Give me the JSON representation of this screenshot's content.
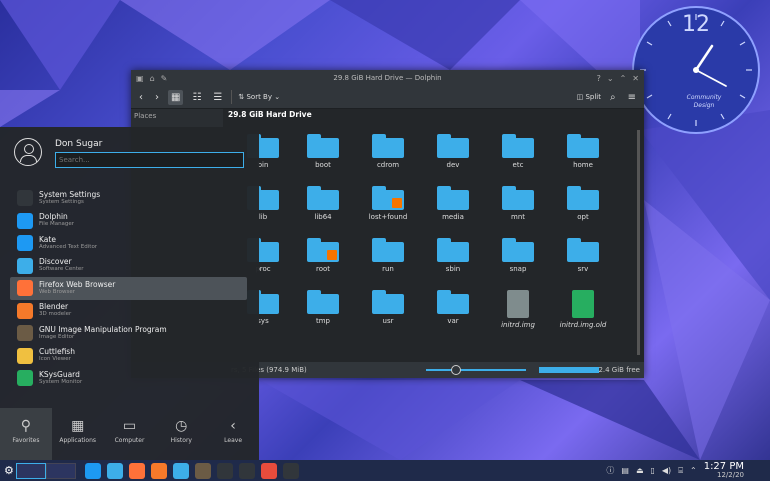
{
  "clock_widget": {
    "twelve": "12",
    "brand_line1": "Community",
    "brand_line2": "Design"
  },
  "dolphin": {
    "title": "29.8 GiB Hard Drive — Dolphin",
    "help": "?",
    "sort_by": "Sort By",
    "split": "Split",
    "places": "Places",
    "breadcrumb": "29.8 GiB Hard Drive",
    "files": [
      {
        "name": "bin",
        "type": "folder"
      },
      {
        "name": "boot",
        "type": "folder"
      },
      {
        "name": "cdrom",
        "type": "folder"
      },
      {
        "name": "dev",
        "type": "folder"
      },
      {
        "name": "etc",
        "type": "folder"
      },
      {
        "name": "home",
        "type": "folder"
      },
      {
        "name": "lib",
        "type": "folder"
      },
      {
        "name": "lib64",
        "type": "folder"
      },
      {
        "name": "lost+found",
        "type": "folder-locked"
      },
      {
        "name": "media",
        "type": "folder"
      },
      {
        "name": "mnt",
        "type": "folder"
      },
      {
        "name": "opt",
        "type": "folder"
      },
      {
        "name": "proc",
        "type": "folder"
      },
      {
        "name": "root",
        "type": "folder-locked"
      },
      {
        "name": "run",
        "type": "folder"
      },
      {
        "name": "sbin",
        "type": "folder"
      },
      {
        "name": "snap",
        "type": "folder"
      },
      {
        "name": "srv",
        "type": "folder"
      },
      {
        "name": "sys",
        "type": "folder"
      },
      {
        "name": "tmp",
        "type": "folder"
      },
      {
        "name": "usr",
        "type": "folder"
      },
      {
        "name": "var",
        "type": "folder"
      },
      {
        "name": "initrd.img",
        "type": "file"
      },
      {
        "name": "initrd.img.old",
        "type": "file-green"
      }
    ],
    "status_text": "rs, 5 Files (974.9 MiB)",
    "free_space": "2.4 GiB free"
  },
  "launcher": {
    "user": "Don Sugar",
    "search_placeholder": "Search...",
    "apps": [
      {
        "name": "System Settings",
        "desc": "System Settings",
        "color": "#31363b"
      },
      {
        "name": "Dolphin",
        "desc": "File Manager",
        "color": "#1d99f3"
      },
      {
        "name": "Kate",
        "desc": "Advanced Text Editor",
        "color": "#1d99f3"
      },
      {
        "name": "Discover",
        "desc": "Software Center",
        "color": "#3daee9"
      },
      {
        "name": "Firefox Web Browser",
        "desc": "Web Browser",
        "color": "#ff7139"
      },
      {
        "name": "Blender",
        "desc": "3D modeler",
        "color": "#f5792a"
      },
      {
        "name": "GNU Image Manipulation Program",
        "desc": "Image Editor",
        "color": "#6b5b45"
      },
      {
        "name": "Cuttlefish",
        "desc": "Icon Viewer",
        "color": "#f0c040"
      },
      {
        "name": "KSysGuard",
        "desc": "System Monitor",
        "color": "#27ae60"
      }
    ],
    "tabs": [
      {
        "label": "Favorites",
        "icon": "⚲"
      },
      {
        "label": "Applications",
        "icon": "▦"
      },
      {
        "label": "Computer",
        "icon": "▭"
      },
      {
        "label": "History",
        "icon": "◷"
      },
      {
        "label": "Leave",
        "icon": "‹"
      }
    ]
  },
  "taskbar": {
    "time": "1:27 PM",
    "date": "12/2/20"
  }
}
